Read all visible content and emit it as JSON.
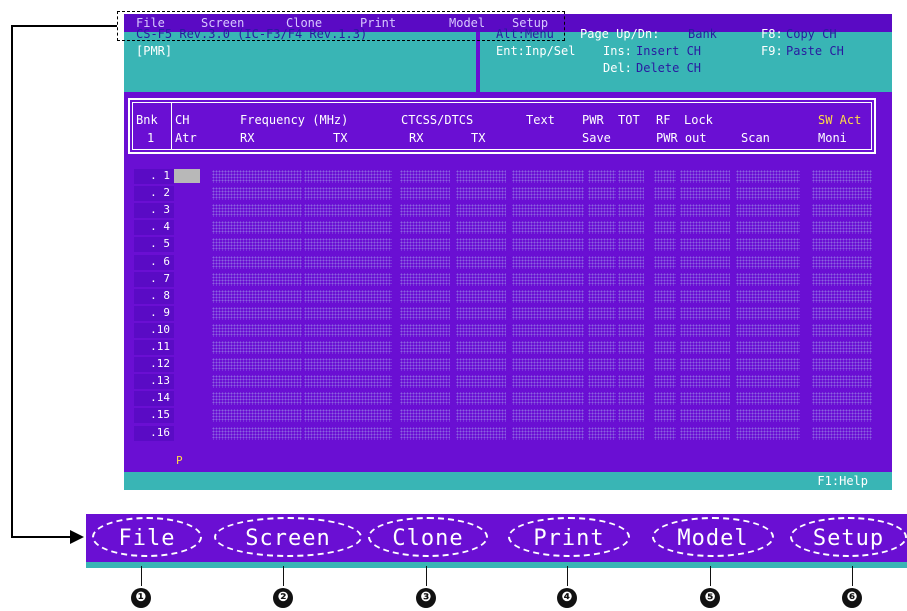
{
  "menu": [
    "File",
    "Screen",
    "Clone",
    "Print",
    "Model",
    "Setup"
  ],
  "info": {
    "model_line": "CS-F5 Rev.3.0 (IC-F3/F4 Rev.1.3)",
    "group": "[PMR]",
    "alt_menu": "Alt:Menu",
    "enter_sel": "Ent:Inp/Sel",
    "page_bank_key": "Page Up/Dn:",
    "page_bank_val": "Bank",
    "ins_key": "Ins:",
    "ins_val": "Insert CH",
    "del_key": "Del:",
    "del_val": "Delete CH",
    "f8_key": "F8:",
    "f8_val": "Copy CH",
    "f9_key": "F9:",
    "f9_val": "Paste CH"
  },
  "header": {
    "bnk": "Bnk",
    "bank_no": "1",
    "ch": "CH",
    "atr": "Atr",
    "frequency": "Frequency (MHz)",
    "rx": "RX",
    "tx": "TX",
    "ctcss": "CTCSS/DTCS",
    "crx": "RX",
    "ctx": "TX",
    "text": "Text",
    "pwr": "PWR",
    "save": "Save",
    "tot": "TOT",
    "rf": "RF",
    "pwrout": "PWR out",
    "lock": "Lock",
    "scan": "Scan",
    "swact": "SW Act",
    "moni": "Moni"
  },
  "channels": [
    ". 1",
    ". 2",
    ". 3",
    ". 4",
    ". 5",
    ". 6",
    ". 7",
    ". 8",
    ". 9",
    ".10",
    ".11",
    ".12",
    ".13",
    ".14",
    ".15",
    ".16"
  ],
  "channel_16_attr": "P",
  "status": {
    "help": "F1:Help"
  },
  "callouts": [
    "❶",
    "❷",
    "❸",
    "❹",
    "❺",
    "❻"
  ]
}
